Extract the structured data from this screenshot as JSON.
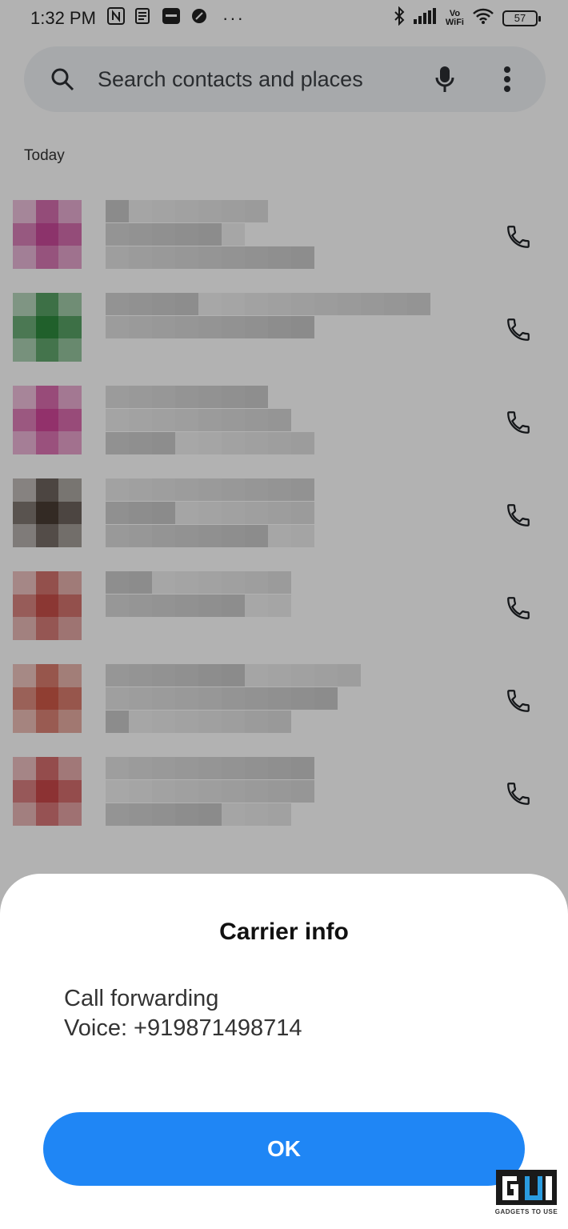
{
  "status_bar": {
    "time": "1:32 PM",
    "left_icons": [
      "nfc-icon",
      "news-icon",
      "paytm-icon",
      "app-icon",
      "more-dots-icon"
    ],
    "right_icons": [
      "bluetooth-icon",
      "signal-icon",
      "vowifi-icon",
      "wifi-icon",
      "battery-icon"
    ],
    "vowifi_label_top": "Vo",
    "vowifi_label_bottom": "WiFi",
    "battery_level": "57"
  },
  "search": {
    "placeholder": "Search contacts and places",
    "icon": "search-icon",
    "mic_icon": "mic-icon",
    "menu_icon": "more-vert-icon"
  },
  "section": {
    "label": "Today"
  },
  "contacts": [
    {
      "avatar_color": "#c94a9a",
      "call_icon": "phone-icon"
    },
    {
      "avatar_color": "#2e8a3e",
      "call_icon": "phone-icon"
    },
    {
      "avatar_color": "#d1479a",
      "call_icon": "phone-icon"
    },
    {
      "avatar_color": "#4a3d34",
      "call_icon": "phone-icon"
    },
    {
      "avatar_color": "#c8504a",
      "call_icon": "phone-icon"
    },
    {
      "avatar_color": "#cf5a48",
      "call_icon": "phone-icon"
    },
    {
      "avatar_color": "#c9484a",
      "call_icon": "phone-icon"
    }
  ],
  "dialog": {
    "title": "Carrier info",
    "line1": "Call forwarding",
    "line2": "Voice: +919871498714",
    "ok_label": "OK"
  },
  "watermark": {
    "text": "GADGETS TO USE"
  },
  "colors": {
    "accent": "#1f86f5",
    "search_bg": "#f0f2f5"
  }
}
